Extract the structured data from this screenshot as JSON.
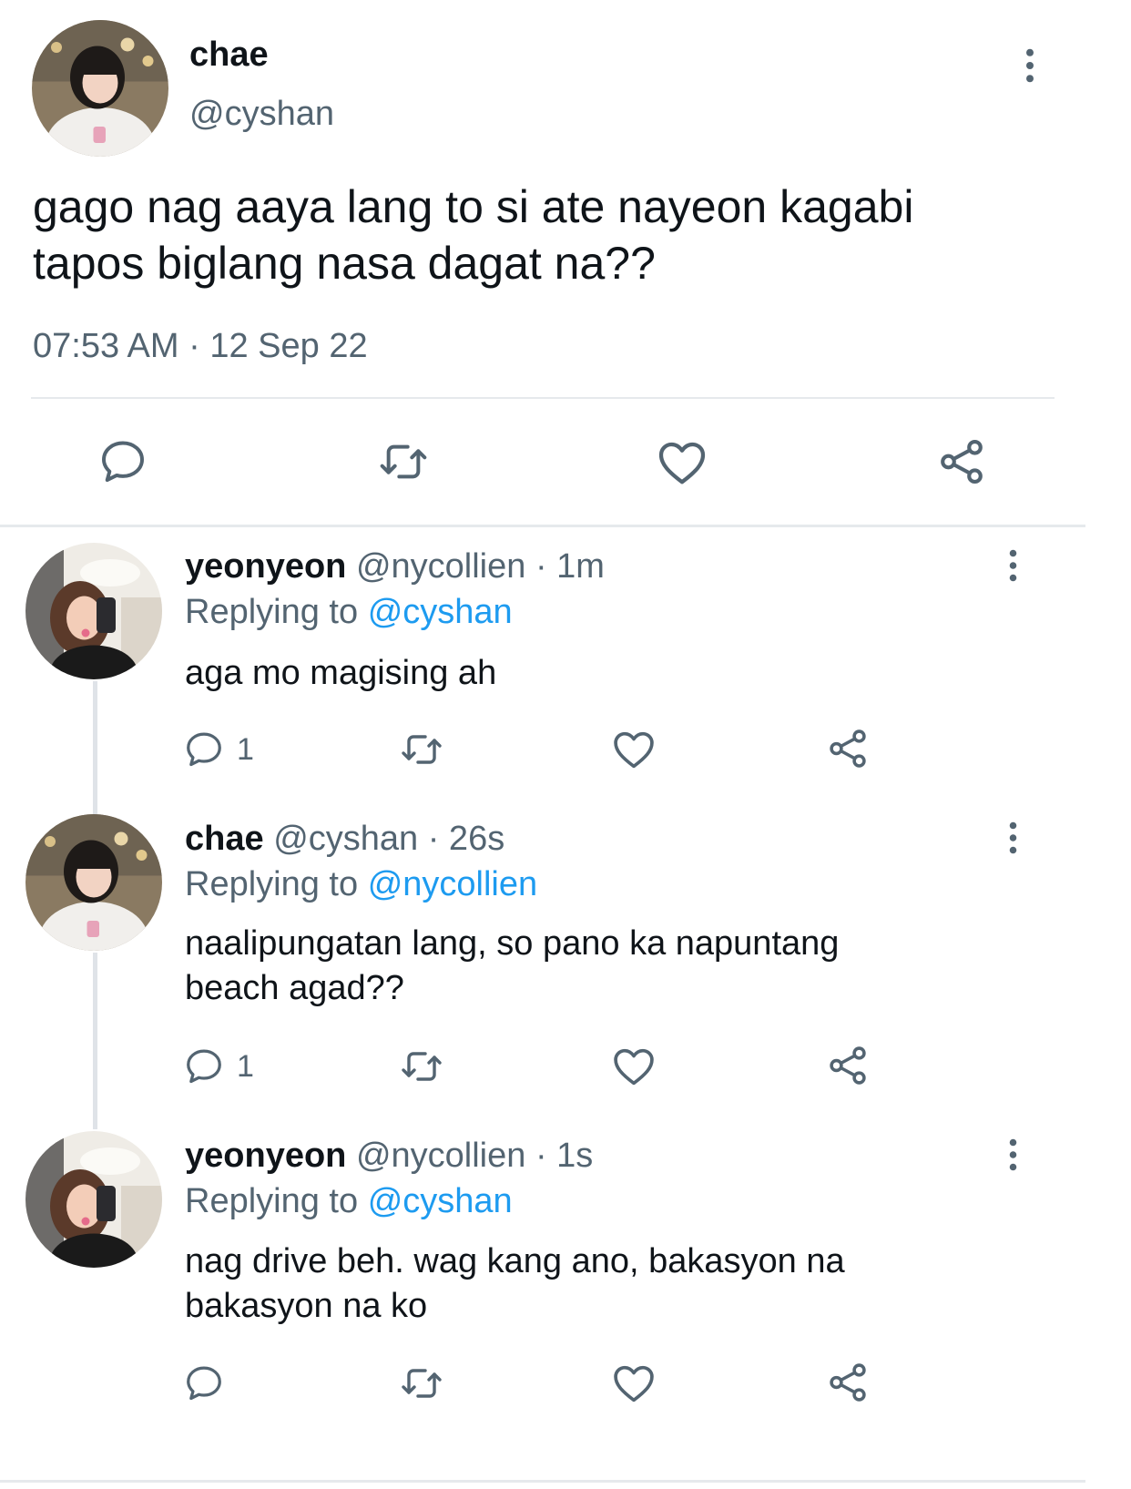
{
  "main_tweet": {
    "display_name": "chae",
    "handle": "@cyshan",
    "text_line1": "gago nag aaya lang to si ate nayeon kagabi",
    "text_line2": "tapos biglang nasa dagat na??",
    "timestamp": "07:53 AM · 12 Sep 22"
  },
  "replies": [
    {
      "display_name": "yeonyeon",
      "meta": "@nycollien · 1m",
      "replying_prefix": "Replying to",
      "replying_to": "@cyshan",
      "text_line1": "aga mo magising ah",
      "text_line2": "",
      "reply_count": "1"
    },
    {
      "display_name": "chae",
      "meta": "@cyshan · 26s",
      "replying_prefix": "Replying to",
      "replying_to": "@nycollien",
      "text_line1": "naalipungatan lang, so pano ka napuntang",
      "text_line2": "beach agad??",
      "reply_count": "1"
    },
    {
      "display_name": "yeonyeon",
      "meta": "@nycollien · 1s",
      "replying_prefix": "Replying to",
      "replying_to": "@cyshan",
      "text_line1": "nag drive beh. wag kang ano, bakasyon na",
      "text_line2": "bakasyon na ko",
      "reply_count": ""
    }
  ],
  "icons": [
    "more-icon",
    "reply-icon",
    "retweet-icon",
    "like-icon",
    "share-icon"
  ],
  "colors": {
    "text": "#0f1419",
    "muted": "#536471",
    "link": "#1d9bf0",
    "divider": "#e6e9ec"
  }
}
